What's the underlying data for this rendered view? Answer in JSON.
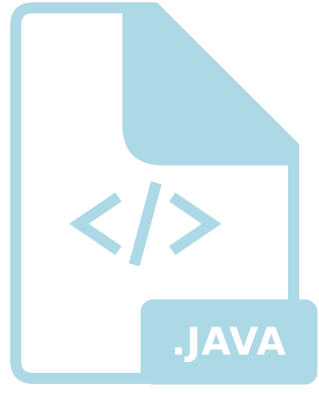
{
  "file_icon": {
    "icon": "java-file-icon",
    "code_symbol_icon": "code-brackets-icon",
    "badge_text": ".JAVA"
  },
  "colors": {
    "primary": "#ADD8E6",
    "background": "#ffffff",
    "badge_text": "#ffffff"
  }
}
